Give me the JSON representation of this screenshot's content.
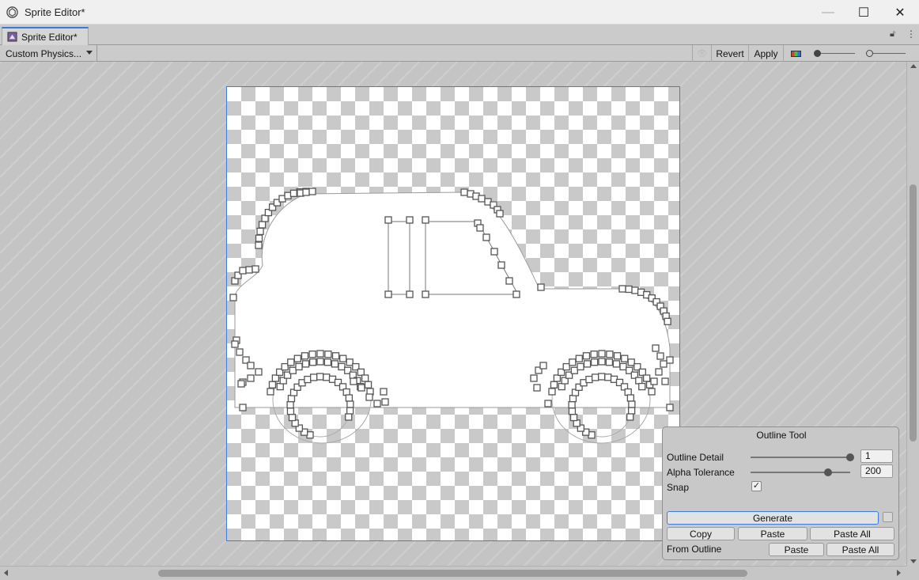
{
  "window": {
    "title": "Sprite Editor*",
    "controls": {
      "minimize": "—",
      "maximize": "☐",
      "close": "✕"
    }
  },
  "tab": {
    "label": "Sprite Editor*"
  },
  "toolbar": {
    "mode_dropdown": "Custom Physics...",
    "revert_label": "Revert",
    "apply_label": "Apply"
  },
  "outline_tool": {
    "title": "Outline Tool",
    "outline_detail_label": "Outline Detail",
    "outline_detail_value": "1",
    "outline_detail_fraction": 1.0,
    "alpha_tolerance_label": "Alpha Tolerance",
    "alpha_tolerance_value": "200",
    "alpha_tolerance_fraction": 0.78,
    "snap_label": "Snap",
    "snap_checked": true,
    "generate_label": "Generate",
    "copy_label": "Copy",
    "paste_label": "Paste",
    "paste_all_label": "Paste All",
    "from_outline_label": "From Outline",
    "from_outline_paste_label": "Paste",
    "from_outline_paste_all_label": "Paste All"
  },
  "icons": {
    "app": "unity-logo-icon",
    "tab": "sprite-editor-icon",
    "lock": "lock-icon",
    "menu": "kebab-menu-icon",
    "eye": "eye-icon",
    "color_channel": "rgb-channel-icon"
  },
  "colors": {
    "accent": "#3d7ce0",
    "outline_handles": "#666666"
  }
}
